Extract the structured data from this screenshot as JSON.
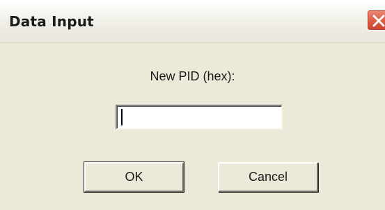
{
  "window": {
    "title": "Data Input",
    "close_icon": "close-icon"
  },
  "form": {
    "prompt_label": "New PID (hex):",
    "pid_value": "",
    "ok_label": "OK",
    "cancel_label": "Cancel"
  },
  "colors": {
    "dialog_background": "#ece9d8",
    "close_button": "#dc5b44"
  }
}
